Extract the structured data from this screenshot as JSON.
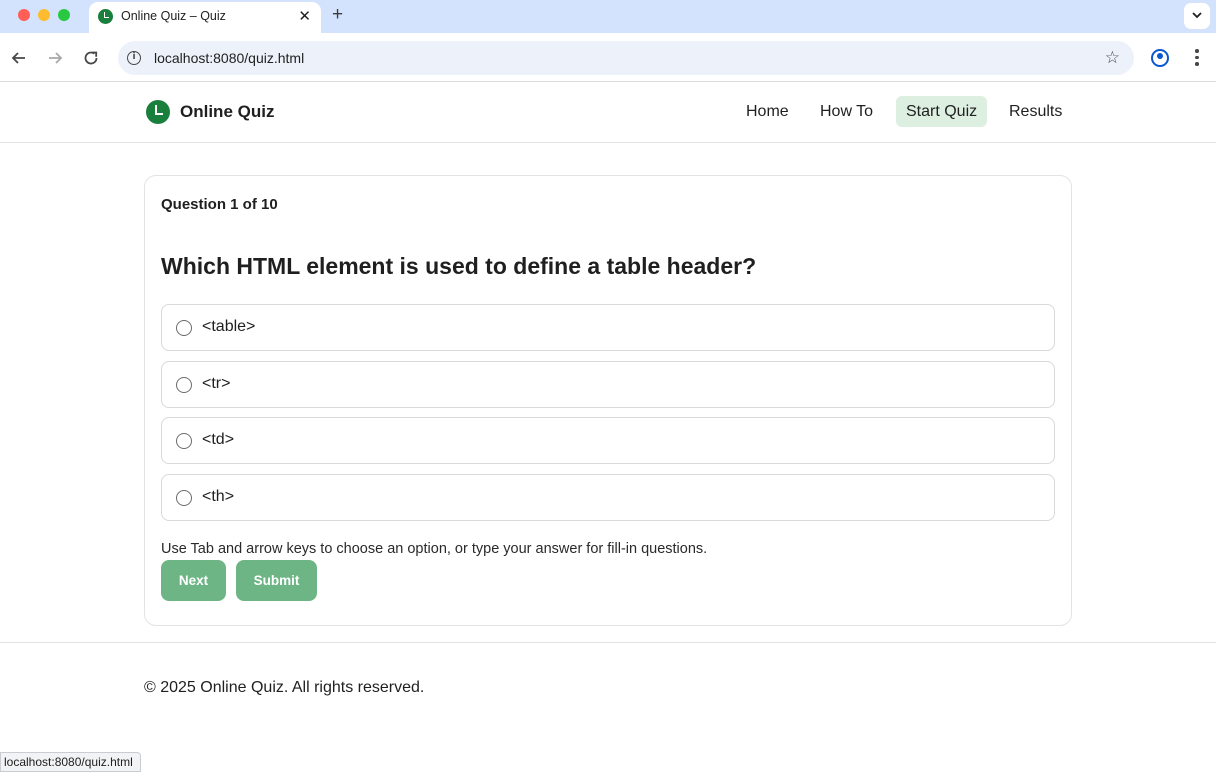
{
  "browser": {
    "tab_title": "Online Quiz – Quiz",
    "url": "localhost:8080/quiz.html",
    "status_url": "localhost:8080/quiz.html"
  },
  "site": {
    "brand": "Online Quiz",
    "nav": [
      {
        "label": "Home",
        "active": false
      },
      {
        "label": "How To",
        "active": false
      },
      {
        "label": "Start Quiz",
        "active": true
      },
      {
        "label": "Results",
        "active": false
      }
    ]
  },
  "quiz": {
    "counter": "Question 1 of 10",
    "question": "Which HTML element is used to define a table header?",
    "options": [
      "<table>",
      "<tr>",
      "<td>",
      "<th>"
    ],
    "hint": "Use Tab and arrow keys to choose an option, or type your answer for fill-in questions.",
    "next_label": "Next",
    "submit_label": "Submit"
  },
  "footer": {
    "copyright": "© 2025 Online Quiz. All rights reserved."
  },
  "colors": {
    "brand_green": "#1a7f3c",
    "button_green": "#6db585",
    "active_nav_bg": "#dcefe1",
    "tabstrip": "#d3e3fd"
  }
}
